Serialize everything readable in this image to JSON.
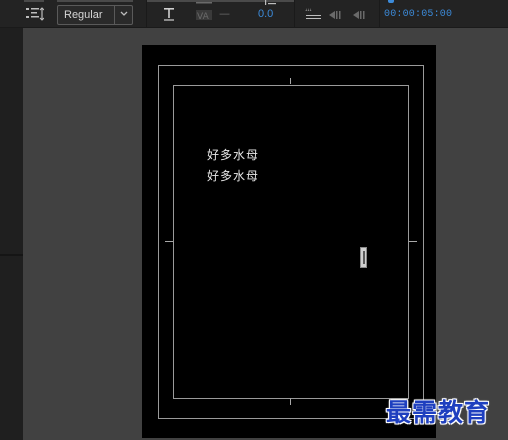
{
  "toolbar": {
    "font_style_value": "Regular",
    "kerning_value": "0.0",
    "tracking_placeholder": "—",
    "timecode": "00:00:05:00",
    "accent_color": "#3c8bda",
    "icons": [
      "align-options-icon",
      "chevron-down-icon",
      "text-tool-icon",
      "tracking-icon",
      "kerning-icon",
      "keyframe-navigation-icons"
    ]
  },
  "canvas": {
    "text_lines": [
      "好多水母",
      "好多水母"
    ]
  },
  "watermark": {
    "text": "最需教育",
    "color": "#1e3fbf"
  }
}
